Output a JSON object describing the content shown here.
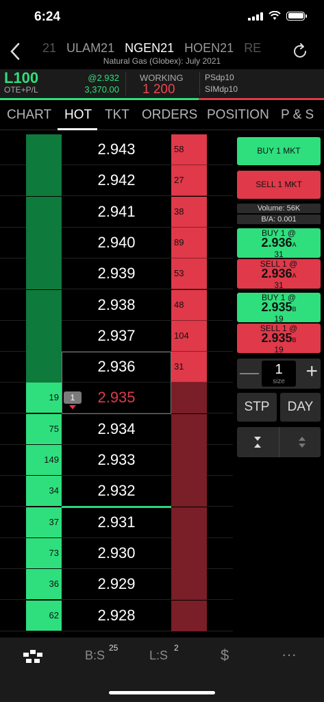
{
  "status_bar": {
    "time": "6:24"
  },
  "header": {
    "symbols": [
      "21",
      "ULAM21",
      "NGEN21",
      "HOEN21",
      "RE"
    ],
    "active_symbol_index": 2,
    "contract_name": "Natural Gas (Globex): July 2021"
  },
  "account": {
    "id": "L100",
    "pnl_label": "OTE+P/L",
    "price": "@2.932",
    "pnl": "3,370.00",
    "working_label": "WORKING",
    "working_value": "1  200",
    "strategy1": "PSdp10",
    "strategy2": "SIMdp10"
  },
  "tabs": [
    "CHART",
    "HOT",
    "TKT",
    "ORDERS",
    "POSITION",
    "P & S"
  ],
  "active_tab": "HOT",
  "ladder": {
    "rows": [
      {
        "price": "2.943",
        "bid": "",
        "ask": "58"
      },
      {
        "price": "2.942",
        "bid": "",
        "ask": "27"
      },
      {
        "price": "2.941",
        "bid": "",
        "ask": "38"
      },
      {
        "price": "2.940",
        "bid": "",
        "ask": "89"
      },
      {
        "price": "2.939",
        "bid": "",
        "ask": "53"
      },
      {
        "price": "2.938",
        "bid": "",
        "ask": "48"
      },
      {
        "price": "2.937",
        "bid": "",
        "ask": "104"
      },
      {
        "price": "2.936",
        "bid": "",
        "ask": "31"
      },
      {
        "price": "2.935",
        "bid": "19",
        "ask": ""
      },
      {
        "price": "2.934",
        "bid": "75",
        "ask": ""
      },
      {
        "price": "2.933",
        "bid": "149",
        "ask": ""
      },
      {
        "price": "2.932",
        "bid": "34",
        "ask": ""
      },
      {
        "price": "2.931",
        "bid": "37",
        "ask": ""
      },
      {
        "price": "2.930",
        "bid": "73",
        "ask": ""
      },
      {
        "price": "2.929",
        "bid": "36",
        "ask": ""
      },
      {
        "price": "2.928",
        "bid": "62",
        "ask": ""
      }
    ],
    "working_order_qty": "1",
    "working_order_price": "2.935",
    "colors": {
      "bid_dim": "#0e7a3c",
      "bid_bright": "#2fdf7d",
      "ask_bright": "#e0394a",
      "ask_dim": "#7a1e27",
      "sell_text": "#e0394a"
    }
  },
  "panel": {
    "buy_mkt": "BUY 1 MKT",
    "sell_mkt": "SELL 1 MKT",
    "volume": "Volume: 56K",
    "ba": "B/A: 0.001",
    "buy_ask": {
      "l1": "BUY 1 @",
      "price": "2.936",
      "suffix": "A",
      "qty": "31"
    },
    "sell_ask": {
      "l1": "SELL 1 @",
      "price": "2.936",
      "suffix": "A",
      "qty": "31"
    },
    "buy_bid": {
      "l1": "BUY 1 @",
      "price": "2.935",
      "suffix": "B",
      "qty": "19"
    },
    "sell_bid": {
      "l1": "SELL 1 @",
      "price": "2.935",
      "suffix": "B",
      "qty": "19"
    },
    "size_value": "1",
    "size_label": "size",
    "stp": "STP",
    "day": "DAY"
  },
  "bottom_nav": {
    "bs_label": "B:S",
    "bs_count": "25",
    "ls_label": "L:S",
    "ls_count": "2",
    "dollar": "$",
    "more": "···"
  }
}
